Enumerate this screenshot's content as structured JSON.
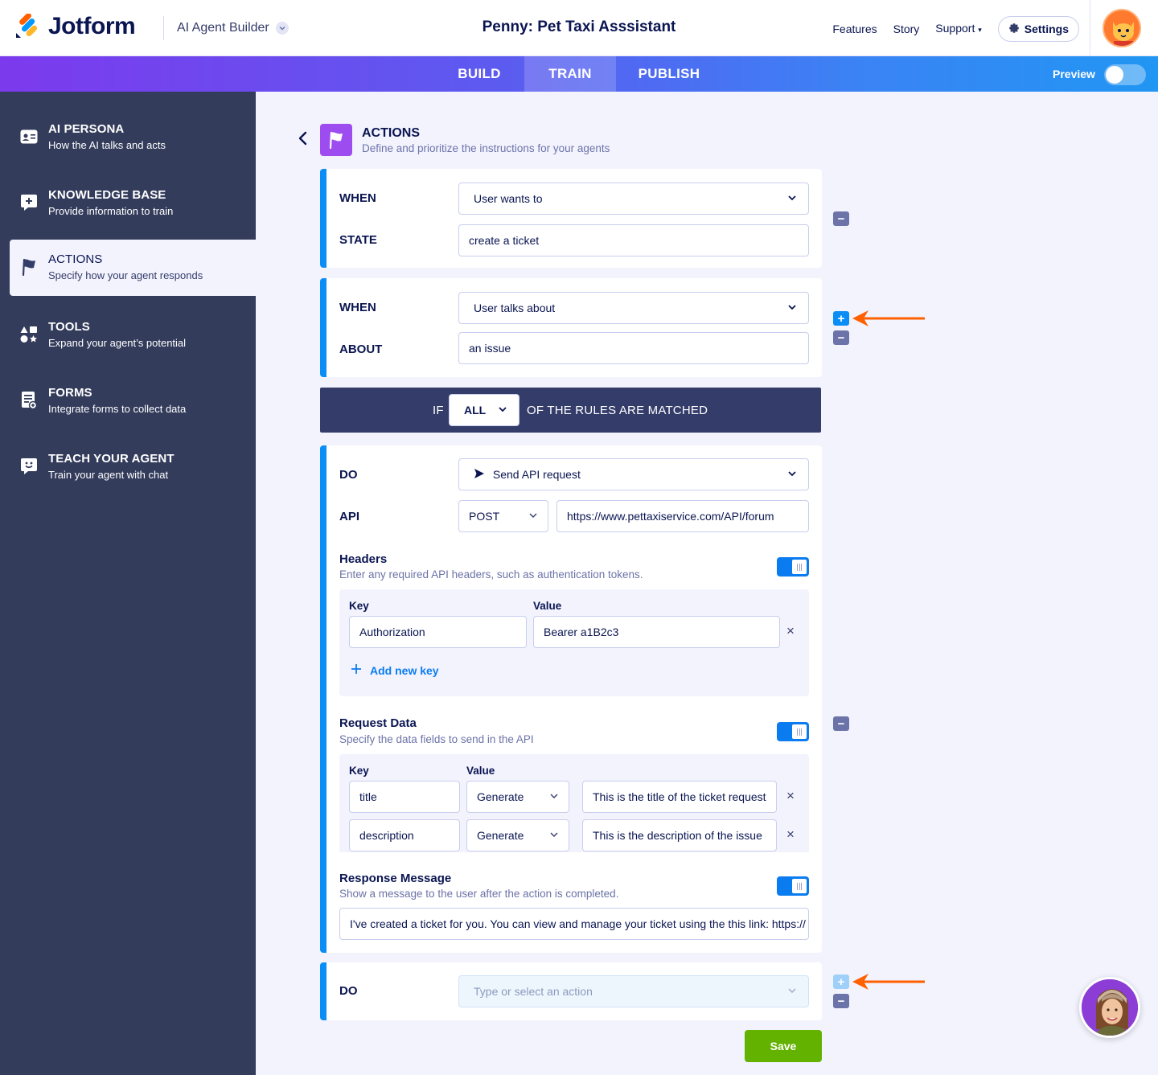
{
  "header": {
    "logo_text": "Jotform",
    "app_name": "AI Agent Builder",
    "agent_title": "Penny: Pet Taxi Asssistant",
    "links": [
      "Features",
      "Story",
      "Support"
    ],
    "settings_label": "Settings"
  },
  "tabs": {
    "build": "BUILD",
    "train": "TRAIN",
    "publish": "PUBLISH",
    "active": "TRAIN",
    "preview_label": "Preview"
  },
  "sidebar": {
    "items": [
      {
        "title": "AI PERSONA",
        "subtitle": "How the AI talks and acts",
        "icon": "id-card-icon"
      },
      {
        "title": "KNOWLEDGE BASE",
        "subtitle": "Provide information to train",
        "icon": "chat-plus-icon"
      },
      {
        "title": "ACTIONS",
        "subtitle": "Specify how your agent responds",
        "icon": "flag-icon",
        "active": true
      },
      {
        "title": "TOOLS",
        "subtitle": "Expand your agent’s potential",
        "icon": "shapes-icon"
      },
      {
        "title": "FORMS",
        "subtitle": "Integrate forms to collect data",
        "icon": "form-icon"
      },
      {
        "title": "TEACH YOUR AGENT",
        "subtitle": "Train your agent with chat",
        "icon": "smile-chat-icon"
      }
    ]
  },
  "page": {
    "title": "ACTIONS",
    "subtitle": "Define and prioritize the instructions for your agents"
  },
  "conditions": [
    {
      "when_label": "WHEN",
      "when_value": "User wants to",
      "field_label": "STATE",
      "field_value": "create a ticket"
    },
    {
      "when_label": "WHEN",
      "when_value": "User talks about",
      "field_label": "ABOUT",
      "field_value": "an issue"
    }
  ],
  "rule": {
    "if": "IF",
    "match": "ALL",
    "suffix": "OF THE RULES ARE MATCHED"
  },
  "action": {
    "do_label": "DO",
    "do_value": "Send API request",
    "api_label": "API",
    "method": "POST",
    "url": "https://www.pettaxiservice.com/API/forum",
    "headers": {
      "title": "Headers",
      "desc": "Enter any required API headers, such as authentication tokens.",
      "key_head": "Key",
      "value_head": "Value",
      "rows": [
        {
          "key": "Authorization",
          "value": "Bearer a1B2c3"
        }
      ],
      "add_label": "Add new key"
    },
    "request_data": {
      "title": "Request Data",
      "desc": "Specify the data fields to send in the API",
      "key_head": "Key",
      "value_head": "Value",
      "rows": [
        {
          "key": "title",
          "mode": "Generate",
          "value": "This is the title of the ticket request"
        },
        {
          "key": "description",
          "mode": "Generate",
          "value": "This is the description of the issue"
        }
      ]
    },
    "response": {
      "title": "Response Message",
      "desc": "Show a message to the user after the action is completed.",
      "value": "I've created a ticket for you. You can view and manage your ticket using the this link: https://"
    }
  },
  "next_action": {
    "do_label": "DO",
    "placeholder": "Type or select an action"
  },
  "save_label": "Save",
  "colors": {
    "accent_blue": "#0a8ef5",
    "sidebar_bg": "#343c5c",
    "save_green": "#64b200",
    "annotation_arrow": "#ff6100"
  }
}
